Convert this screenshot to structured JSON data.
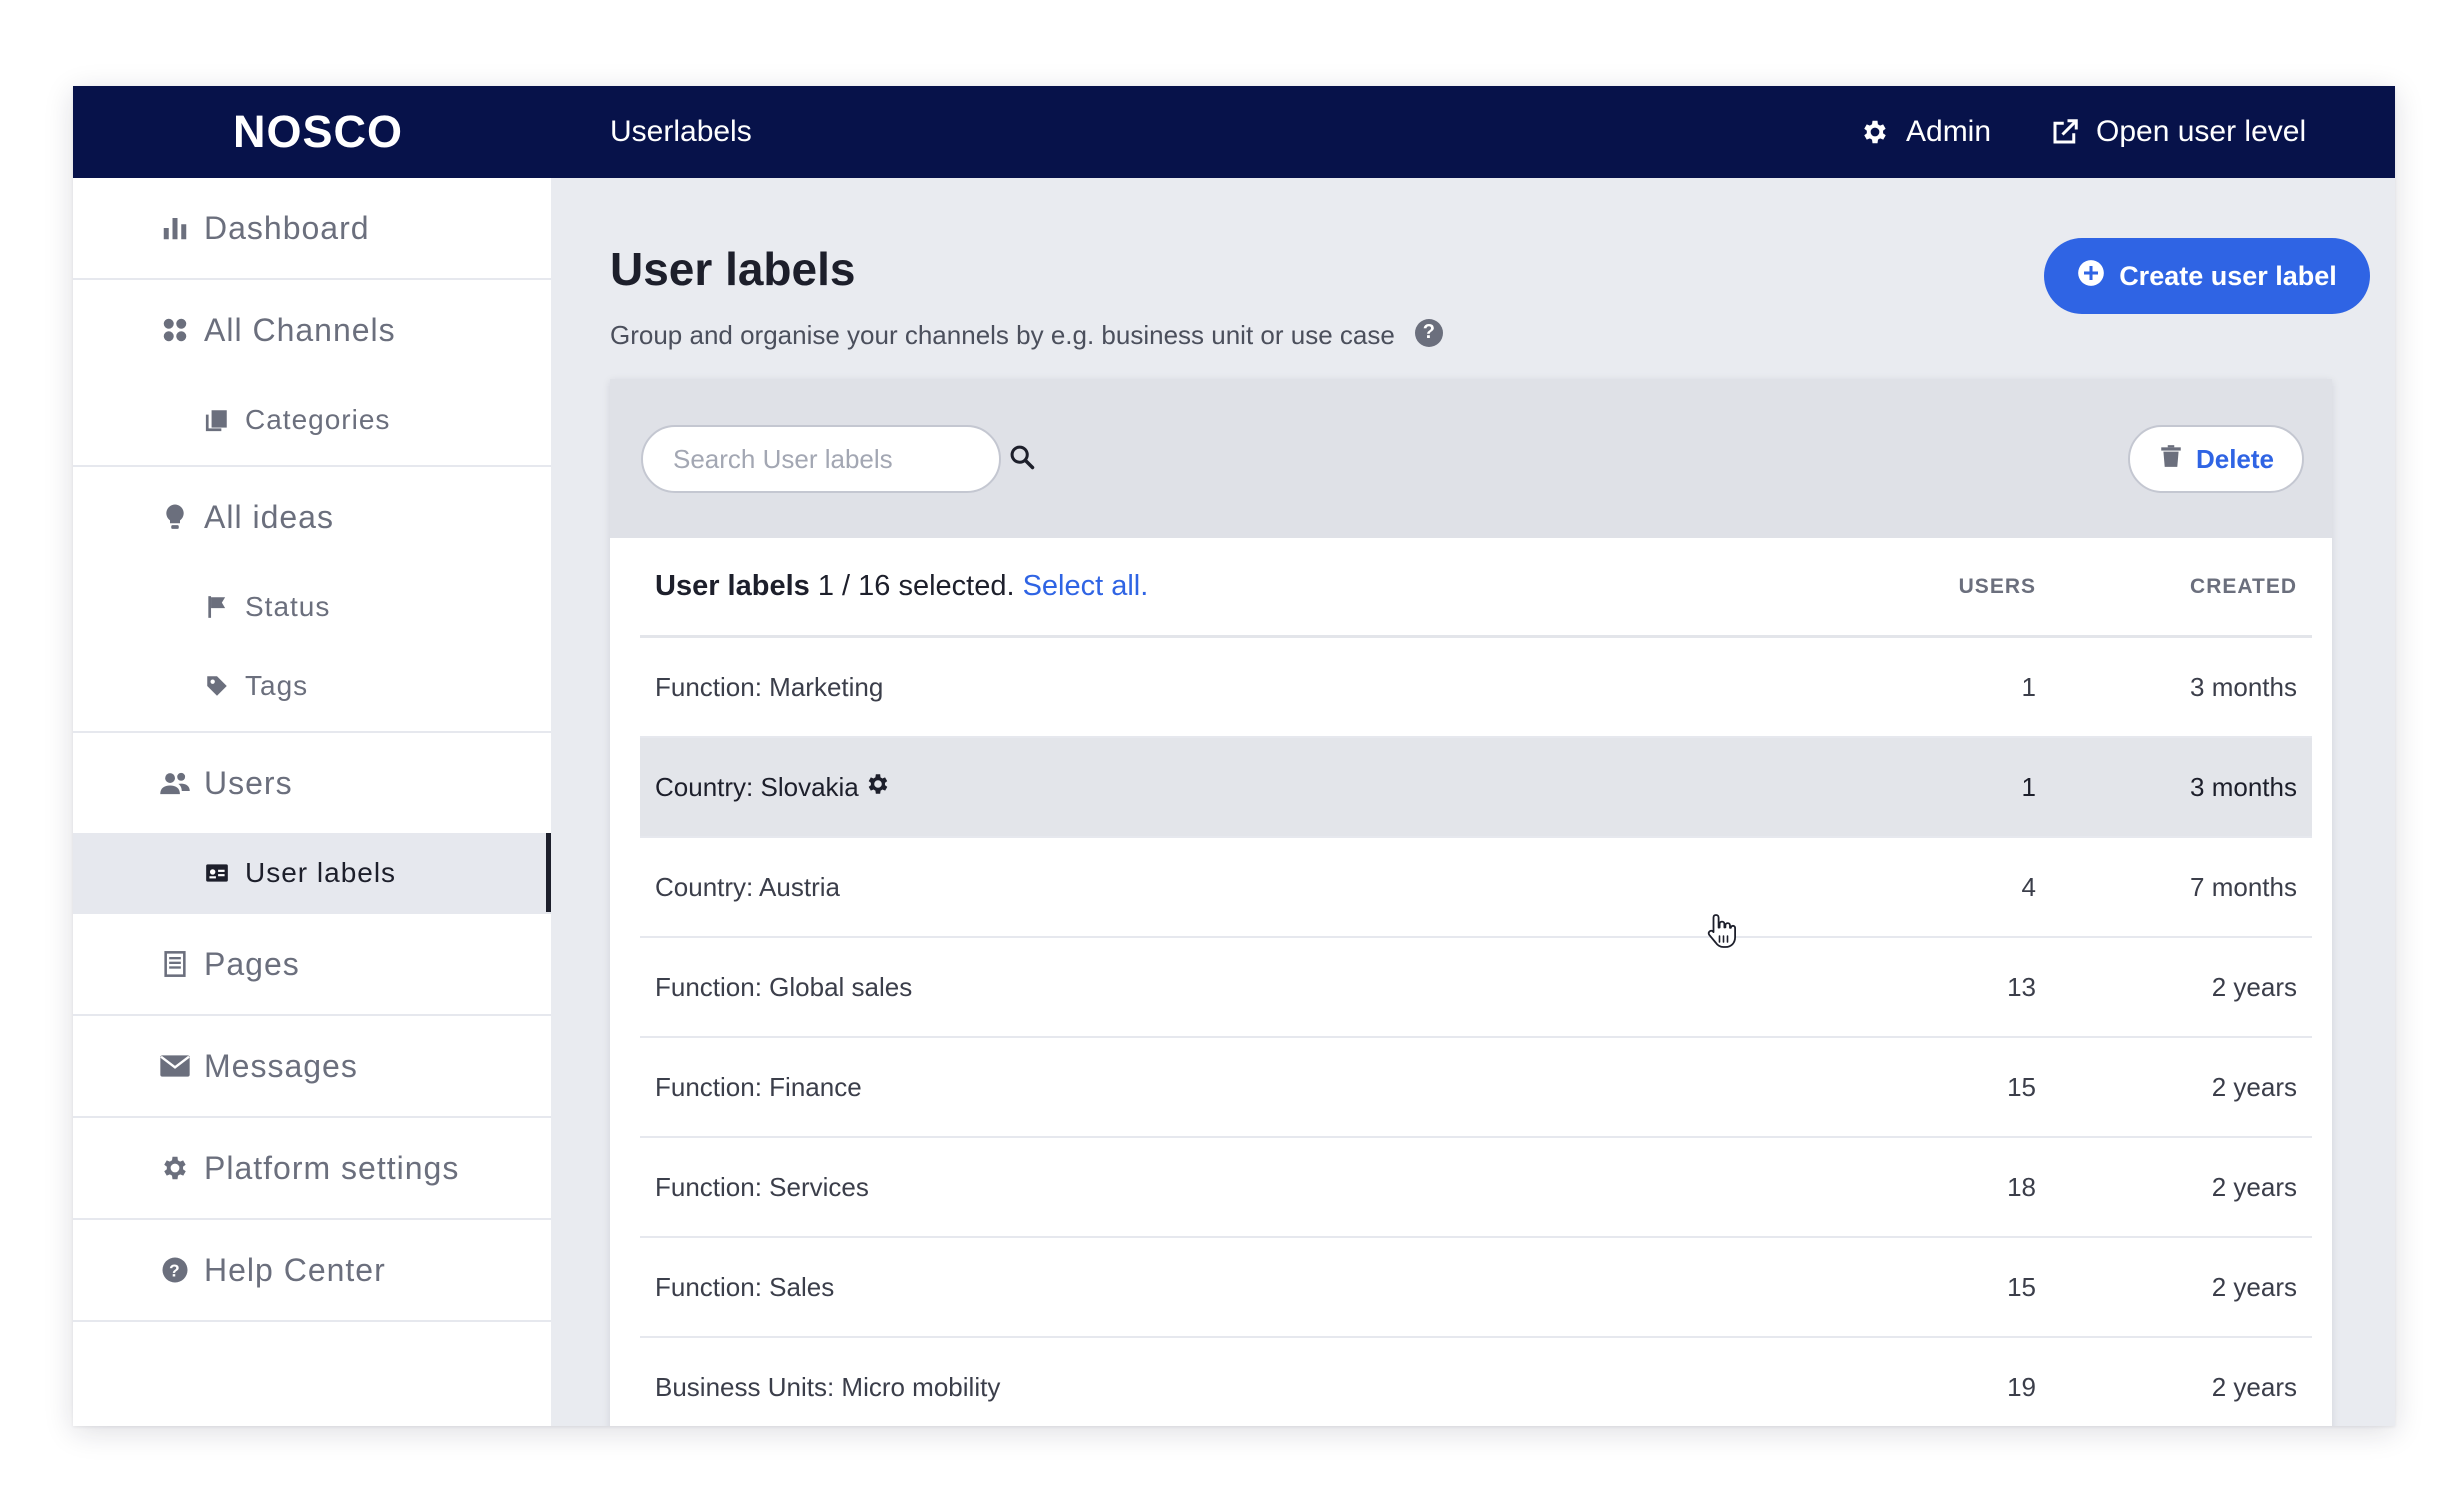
{
  "app": {
    "brand": "NOSCO",
    "page_label": "Userlabels",
    "admin_label": "Admin",
    "open_user_level_label": "Open user level"
  },
  "sidebar": {
    "dashboard": "Dashboard",
    "all_channels": "All Channels",
    "categories": "Categories",
    "all_ideas": "All ideas",
    "status": "Status",
    "tags": "Tags",
    "users": "Users",
    "user_labels": "User labels",
    "pages": "Pages",
    "messages": "Messages",
    "platform_settings": "Platform settings",
    "help_center": "Help Center",
    "active_item": "User labels"
  },
  "main": {
    "title": "User labels",
    "subtitle": "Group and organise your channels by e.g. business unit or use case",
    "help_badge": "?",
    "create_button": "Create user label",
    "search_placeholder": "Search User labels",
    "delete_button": "Delete"
  },
  "table": {
    "heading": "User labels",
    "selection": "1 / 16 selected.",
    "select_all": "Select all.",
    "columns": {
      "users": "USERS",
      "created": "CREATED"
    },
    "rows": [
      {
        "name": "Function: Marketing",
        "users": "1",
        "created": "3 months",
        "selected": false
      },
      {
        "name": "Country: Slovakia",
        "users": "1",
        "created": "3 months",
        "selected": true
      },
      {
        "name": "Country: Austria",
        "users": "4",
        "created": "7 months",
        "selected": false
      },
      {
        "name": "Function: Global sales",
        "users": "13",
        "created": "2 years",
        "selected": false
      },
      {
        "name": "Function: Finance",
        "users": "15",
        "created": "2 years",
        "selected": false
      },
      {
        "name": "Function: Services",
        "users": "18",
        "created": "2 years",
        "selected": false
      },
      {
        "name": "Function: Sales",
        "users": "15",
        "created": "2 years",
        "selected": false
      },
      {
        "name": "Business Units: Micro mobility",
        "users": "19",
        "created": "2 years",
        "selected": false
      }
    ]
  },
  "colors": {
    "topbar": "#07124a",
    "accent": "#2f64e4",
    "selected_row": "#e3e5ea",
    "page_background": "#e9ebf0"
  },
  "icons": {
    "admin": "gear-icon",
    "open_user_level": "external-link-icon",
    "search": "search-icon",
    "delete": "trash-icon",
    "create": "plus-circle-icon",
    "row_settings": "gear-icon",
    "cursor": "hand-pointer-icon"
  }
}
